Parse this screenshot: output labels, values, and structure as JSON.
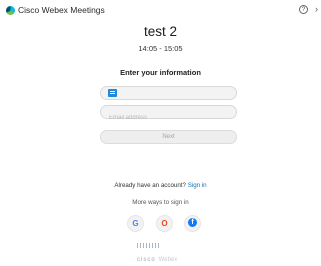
{
  "app": {
    "title": "Cisco Webex Meetings"
  },
  "meeting": {
    "title": "test 2",
    "time": "14:05 - 15:05"
  },
  "form": {
    "heading": "Enter your information",
    "name_value": "",
    "email_placeholder": "Email address",
    "next_label": "Next"
  },
  "signin": {
    "prompt": "Already have an account?",
    "link": "Sign in",
    "more_ways": "More ways to sign in"
  },
  "providers": [
    {
      "icon": "google-icon",
      "glyph": "G"
    },
    {
      "icon": "office-icon",
      "glyph": "O"
    },
    {
      "icon": "facebook-icon",
      "glyph": "f"
    }
  ],
  "footer": {
    "brand": "cisco",
    "product": "Webex"
  },
  "colors": {
    "accent": "#0b6fb8",
    "field_bg": "#f3f3f3"
  }
}
